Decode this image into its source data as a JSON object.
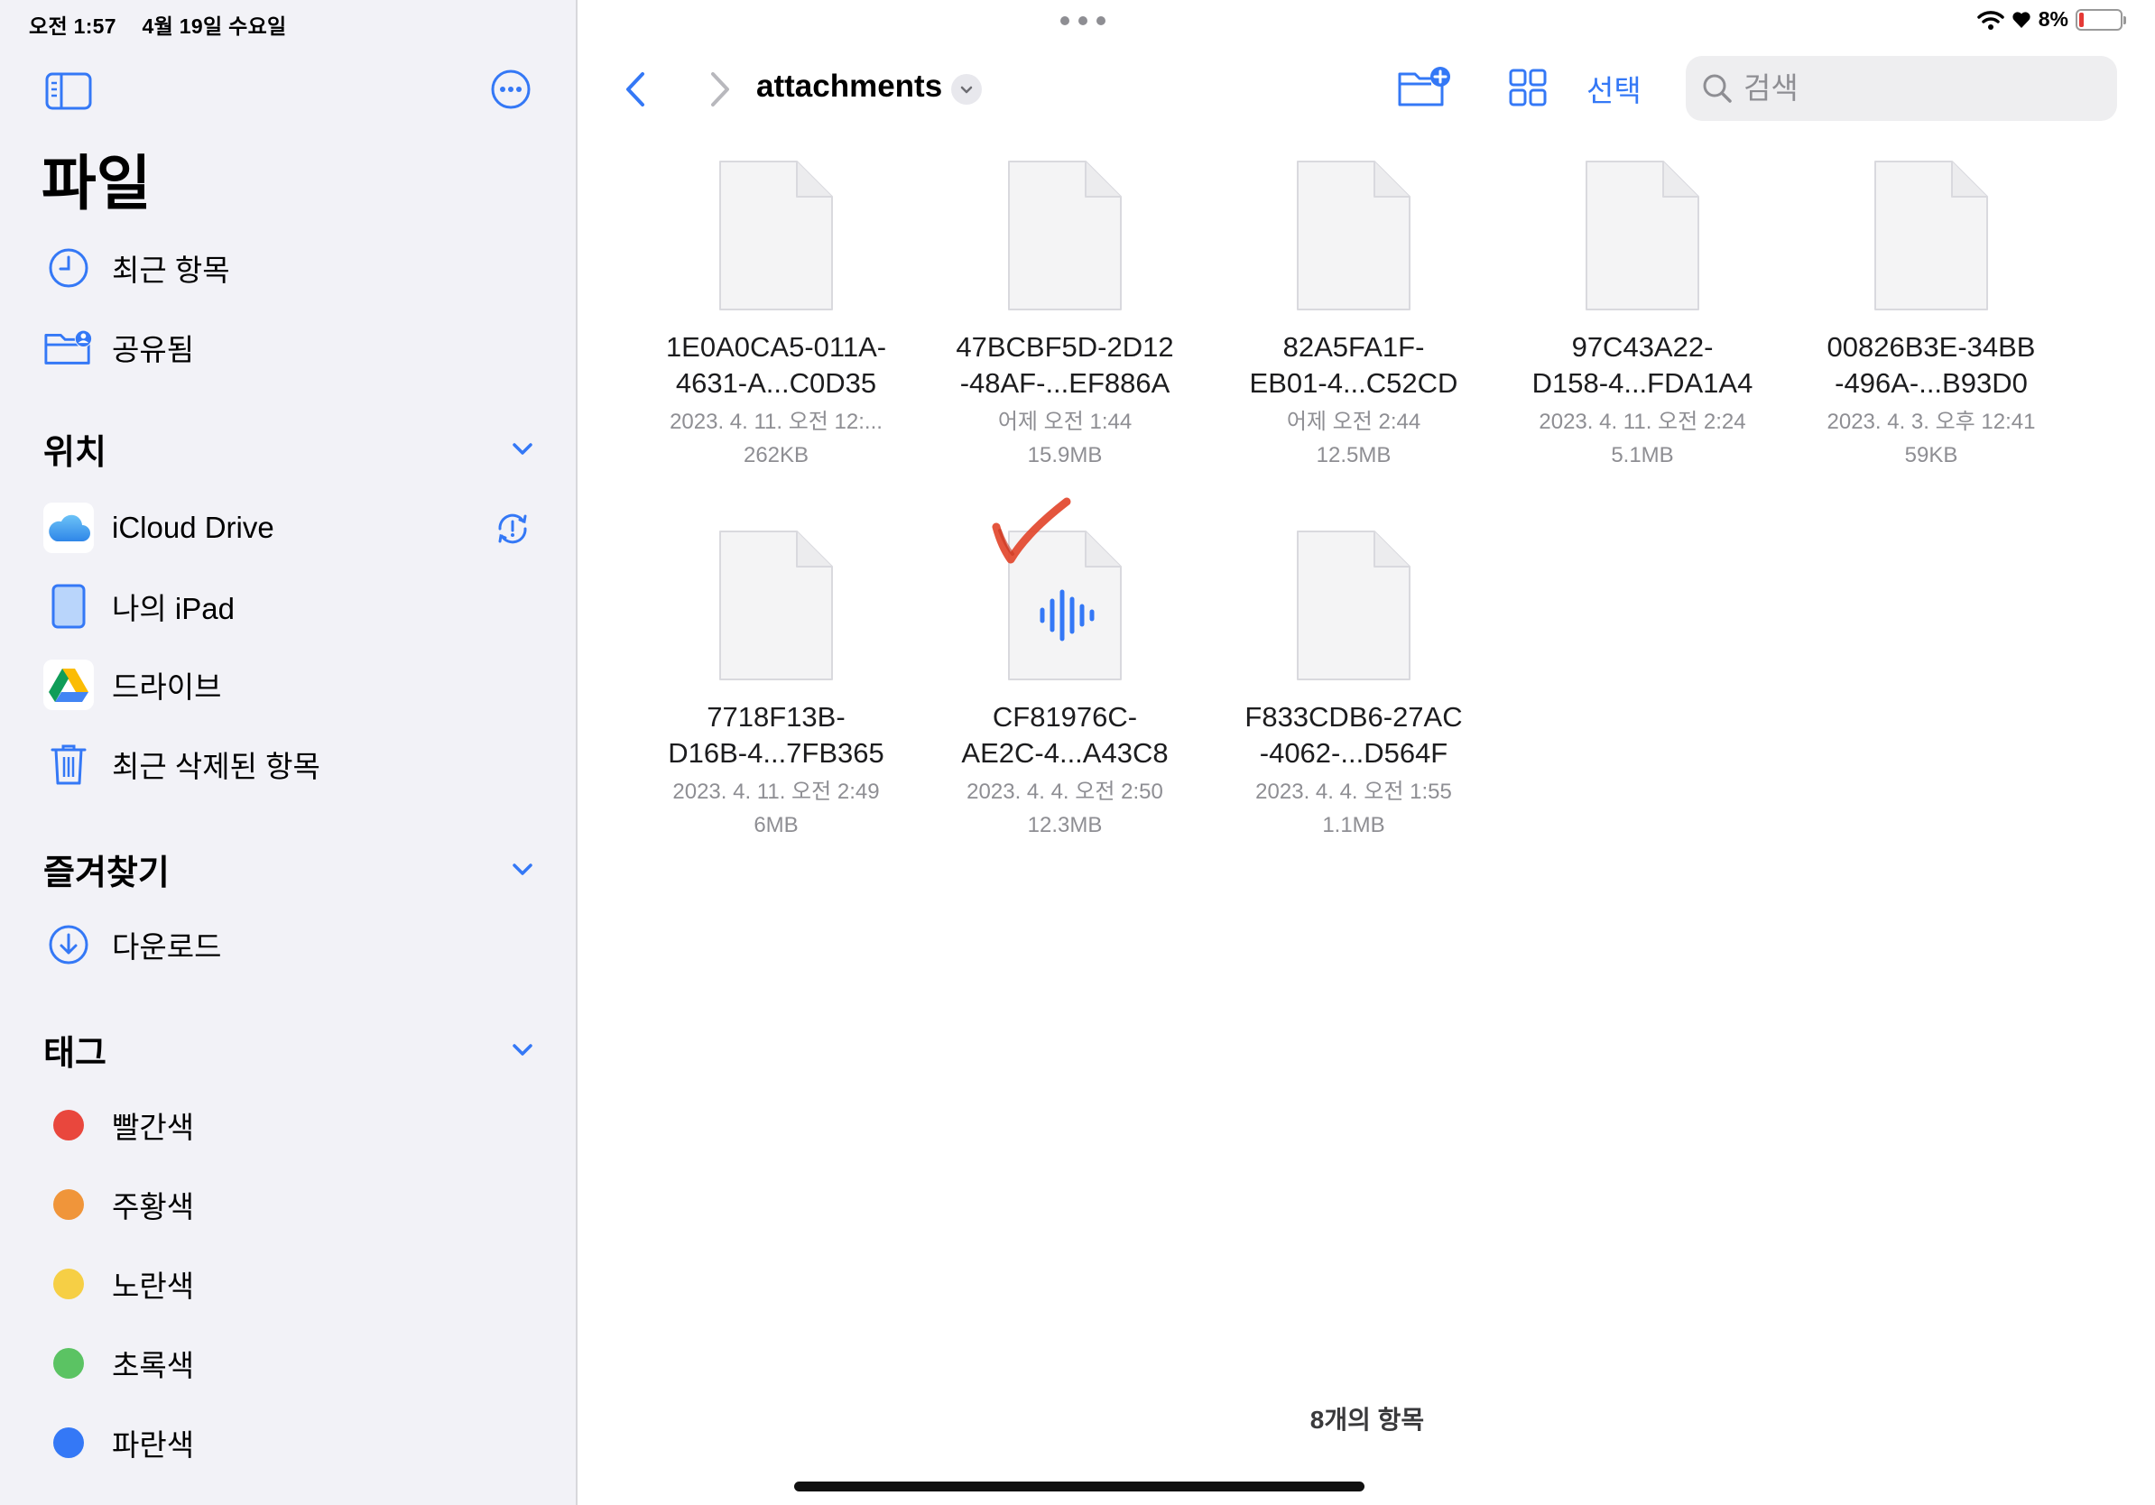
{
  "status": {
    "time": "오전 1:57",
    "date": "4월 19일 수요일",
    "battery": "8%"
  },
  "sidebar": {
    "title": "파일",
    "top_items": [
      {
        "label": "최근 항목",
        "icon": "clock-icon"
      },
      {
        "label": "공유됨",
        "icon": "shared-folder-icon"
      }
    ],
    "locations": {
      "heading": "위치",
      "items": [
        {
          "label": "iCloud Drive",
          "icon": "icloud-icon"
        },
        {
          "label": "나의 iPad",
          "icon": "ipad-icon"
        },
        {
          "label": "드라이브",
          "icon": "google-drive-icon"
        },
        {
          "label": "최근 삭제된 항목",
          "icon": "trash-icon"
        }
      ]
    },
    "favorites": {
      "heading": "즐겨찾기",
      "items": [
        {
          "label": "다운로드",
          "icon": "download-icon"
        }
      ]
    },
    "tags": {
      "heading": "태그",
      "items": [
        {
          "label": "빨간색",
          "color": "#e9473d"
        },
        {
          "label": "주황색",
          "color": "#f0953a"
        },
        {
          "label": "노란색",
          "color": "#f6cf45"
        },
        {
          "label": "초록색",
          "color": "#5bc363"
        },
        {
          "label": "파란색",
          "color": "#3478f6"
        }
      ]
    }
  },
  "toolbar": {
    "folder_title": "attachments",
    "select_label": "선택",
    "search_placeholder": "검색"
  },
  "files": [
    {
      "name1": "1E0A0CA5-011A-",
      "name2": "4631-A...C0D35",
      "date": "2023. 4. 11. 오전 12:...",
      "size": "262KB",
      "type": "doc"
    },
    {
      "name1": "47BCBF5D-2D12",
      "name2": "-48AF-...EF886A",
      "date": "어제 오전 1:44",
      "size": "15.9MB",
      "type": "doc"
    },
    {
      "name1": "82A5FA1F-",
      "name2": "EB01-4...C52CD",
      "date": "어제 오전 2:44",
      "size": "12.5MB",
      "type": "doc"
    },
    {
      "name1": "97C43A22-",
      "name2": "D158-4...FDA1A4",
      "date": "2023. 4. 11. 오전 2:24",
      "size": "5.1MB",
      "type": "doc"
    },
    {
      "name1": "00826B3E-34BB",
      "name2": "-496A-...B93D0",
      "date": "2023. 4. 3. 오후 12:41",
      "size": "59KB",
      "type": "doc"
    },
    {
      "name1": "7718F13B-",
      "name2": "D16B-4...7FB365",
      "date": "2023. 4. 11. 오전 2:49",
      "size": "6MB",
      "type": "doc"
    },
    {
      "name1": "CF81976C-",
      "name2": "AE2C-4...A43C8",
      "date": "2023. 4. 4. 오전 2:50",
      "size": "12.3MB",
      "type": "audio"
    },
    {
      "name1": "F833CDB6-27AC",
      "name2": "-4062-...D564F",
      "date": "2023. 4. 4. 오전 1:55",
      "size": "1.1MB",
      "type": "doc"
    }
  ],
  "footer": {
    "count": "8개의 항목"
  },
  "colors": {
    "accent": "#3478f6",
    "annotation": "#e2462c"
  }
}
